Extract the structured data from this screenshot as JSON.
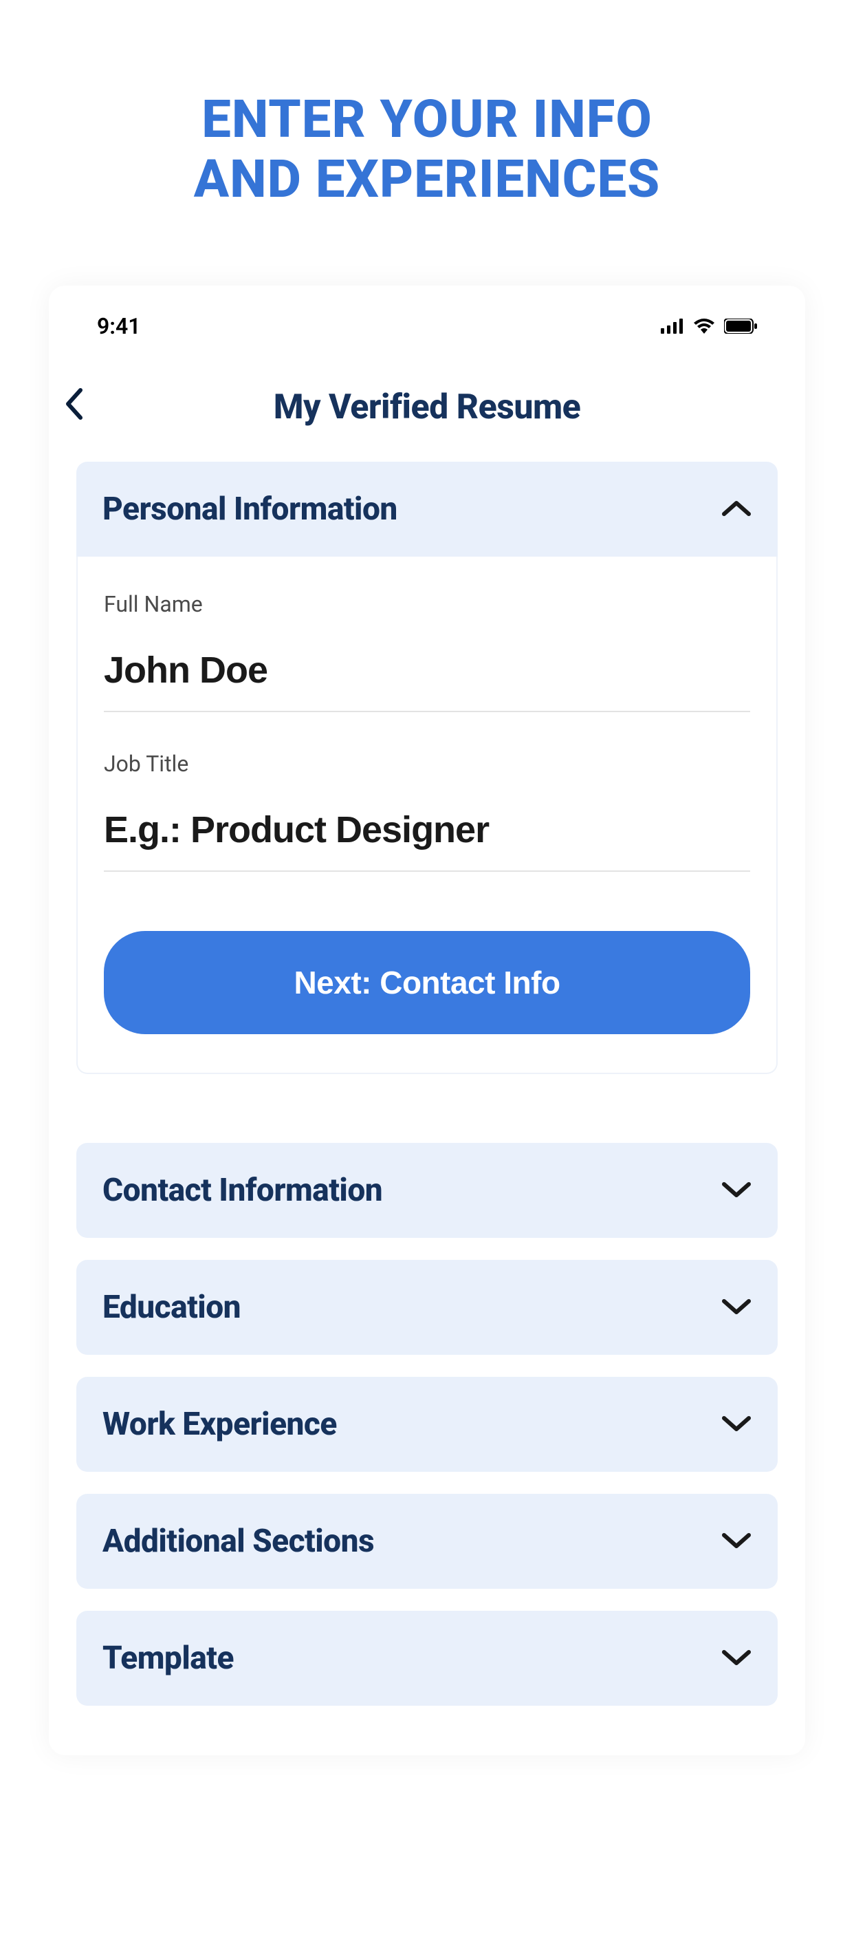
{
  "heading_line1": "ENTER YOUR INFO",
  "heading_line2": "AND EXPERIENCES",
  "status_bar": {
    "time": "9:41"
  },
  "nav": {
    "title": "My Verified Resume"
  },
  "sections": {
    "personal": {
      "title": "Personal Information",
      "fields": {
        "full_name": {
          "label": "Full Name",
          "value": "John Doe"
        },
        "job_title": {
          "label": "Job Title",
          "placeholder": "E.g.: Product Designer"
        }
      },
      "next_button": "Next: Contact Info"
    },
    "contact": {
      "title": "Contact Information"
    },
    "education": {
      "title": "Education"
    },
    "work": {
      "title": "Work Experience"
    },
    "additional": {
      "title": "Additional Sections"
    },
    "template": {
      "title": "Template"
    }
  }
}
